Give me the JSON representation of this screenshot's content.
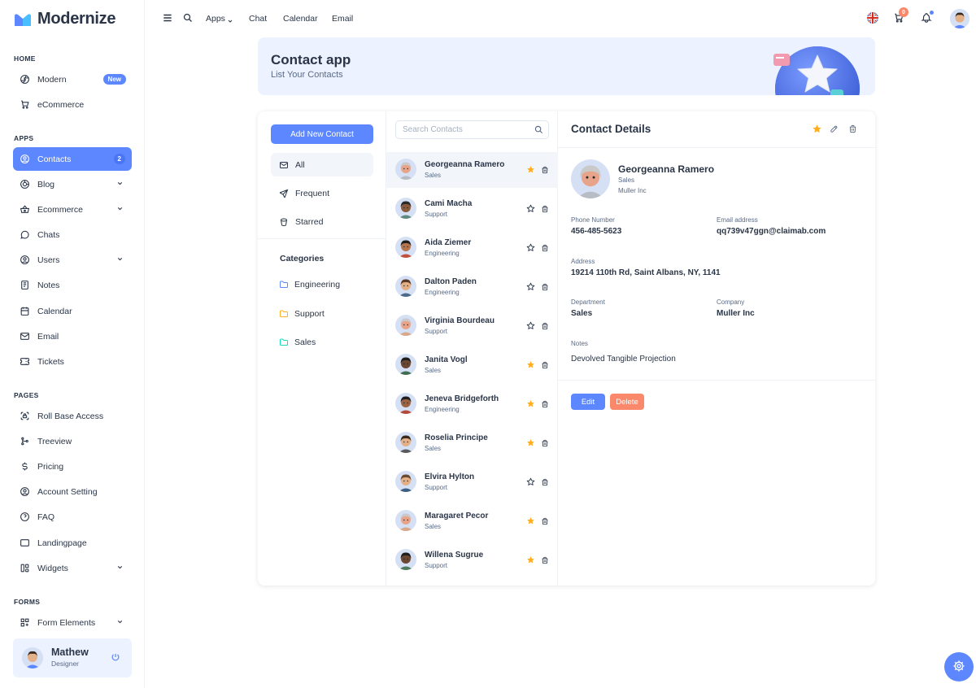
{
  "brand": {
    "name": "Modernize"
  },
  "sidebar": {
    "sections": [
      "HOME",
      "APPS",
      "PAGES",
      "FORMS"
    ],
    "home": [
      {
        "label": "Modern",
        "badge": "New",
        "icon": "aperture-icon"
      },
      {
        "label": "eCommerce",
        "icon": "shopping-cart-icon"
      }
    ],
    "apps": [
      {
        "label": "Contacts",
        "badge": "2",
        "icon": "user-circle-icon"
      },
      {
        "label": "Blog",
        "icon": "chart-donut-icon"
      },
      {
        "label": "Ecommerce",
        "icon": "basket-icon"
      },
      {
        "label": "Chats",
        "icon": "message-icon"
      },
      {
        "label": "Users",
        "icon": "user-icon"
      },
      {
        "label": "Notes",
        "icon": "notes-icon"
      },
      {
        "label": "Calendar",
        "icon": "calendar-icon"
      },
      {
        "label": "Email",
        "icon": "mail-icon"
      },
      {
        "label": "Tickets",
        "icon": "ticket-icon"
      }
    ],
    "pages": [
      {
        "label": "Roll Base Access",
        "icon": "lock-access-icon"
      },
      {
        "label": "Treeview",
        "icon": "git-merge-icon"
      },
      {
        "label": "Pricing",
        "icon": "currency-dollar-icon"
      },
      {
        "label": "Account Setting",
        "icon": "user-settings-icon"
      },
      {
        "label": "FAQ",
        "icon": "help-icon"
      },
      {
        "label": "Landingpage",
        "icon": "app-window-icon"
      },
      {
        "label": "Widgets",
        "icon": "layout-icon"
      }
    ],
    "forms": [
      {
        "label": "Form Elements",
        "icon": "file-text-icon"
      }
    ],
    "profile": {
      "name": "Mathew",
      "role": "Designer"
    }
  },
  "topbar": {
    "links": [
      "Apps",
      "Chat",
      "Calendar",
      "Email"
    ],
    "cart_count": "0"
  },
  "banner": {
    "title": "Contact app",
    "subtitle": "List Your Contacts"
  },
  "contacts_app": {
    "add_button": "Add New Contact",
    "filters": [
      "All",
      "Frequent",
      "Starred"
    ],
    "categories_title": "Categories",
    "categories": [
      "Engineering",
      "Support",
      "Sales"
    ],
    "search_placeholder": "Search Contacts",
    "contacts": [
      {
        "name": "Georgeanna Ramero",
        "dept": "Sales",
        "starred": true,
        "skin": "#e8a48a",
        "hair": "#c9c9c9",
        "shirt": "#b8bcc4"
      },
      {
        "name": "Cami Macha",
        "dept": "Support",
        "starred": false,
        "skin": "#8a5a3c",
        "hair": "#2a2a2a",
        "shirt": "#5d8a7c"
      },
      {
        "name": "Aida Ziemer",
        "dept": "Engineering",
        "starred": false,
        "skin": "#b5754f",
        "hair": "#1f1f1f",
        "shirt": "#c04f3b"
      },
      {
        "name": "Dalton Paden",
        "dept": "Engineering",
        "starred": false,
        "skin": "#e3b088",
        "hair": "#5b3a26",
        "shirt": "#4b6a8c"
      },
      {
        "name": "Virginia Bourdeau",
        "dept": "Support",
        "starred": false,
        "skin": "#e8a48a",
        "hair": "#c9c9c9",
        "shirt": "#d9a88a"
      },
      {
        "name": "Janita Vogl",
        "dept": "Sales",
        "starred": true,
        "skin": "#6b4630",
        "hair": "#1f1f1f",
        "shirt": "#3f6e52"
      },
      {
        "name": "Jeneva Bridgeforth",
        "dept": "Engineering",
        "starred": true,
        "skin": "#9a6444",
        "hair": "#1f1f1f",
        "shirt": "#b34a3c"
      },
      {
        "name": "Roselia Principe",
        "dept": "Sales",
        "starred": true,
        "skin": "#e3b088",
        "hair": "#3a2a1e",
        "shirt": "#5a5a5a"
      },
      {
        "name": "Elvira Hylton",
        "dept": "Support",
        "starred": false,
        "skin": "#e3b088",
        "hair": "#6b4a32",
        "shirt": "#3c5f86"
      },
      {
        "name": "Maragaret Pecor",
        "dept": "Sales",
        "starred": true,
        "skin": "#e8a48a",
        "hair": "#c9c9c9",
        "shirt": "#d9a88a"
      },
      {
        "name": "Willena Sugrue",
        "dept": "Support",
        "starred": true,
        "skin": "#6b4630",
        "hair": "#1f1f1f",
        "shirt": "#4f7a5e"
      }
    ]
  },
  "details": {
    "title": "Contact Details",
    "name": "Georgeanna Ramero",
    "dept": "Sales",
    "company_short": "Muller Inc",
    "phone_label": "Phone Number",
    "phone": "456-485-5623",
    "email_label": "Email address",
    "email": "qq739v47ggn@claimab.com",
    "address_label": "Address",
    "address": "19214 110th Rd, Saint Albans, NY, 1141",
    "department_label": "Department",
    "department": "Sales",
    "company_label": "Company",
    "company": "Muller Inc",
    "notes_label": "Notes",
    "notes": "Devolved Tangible Projection",
    "edit_label": "Edit",
    "delete_label": "Delete"
  },
  "colors": {
    "primary": "#5d87ff",
    "danger": "#fa896b",
    "star": "#ffae1f",
    "text": "#2a3547",
    "light": "#ecf2ff"
  }
}
